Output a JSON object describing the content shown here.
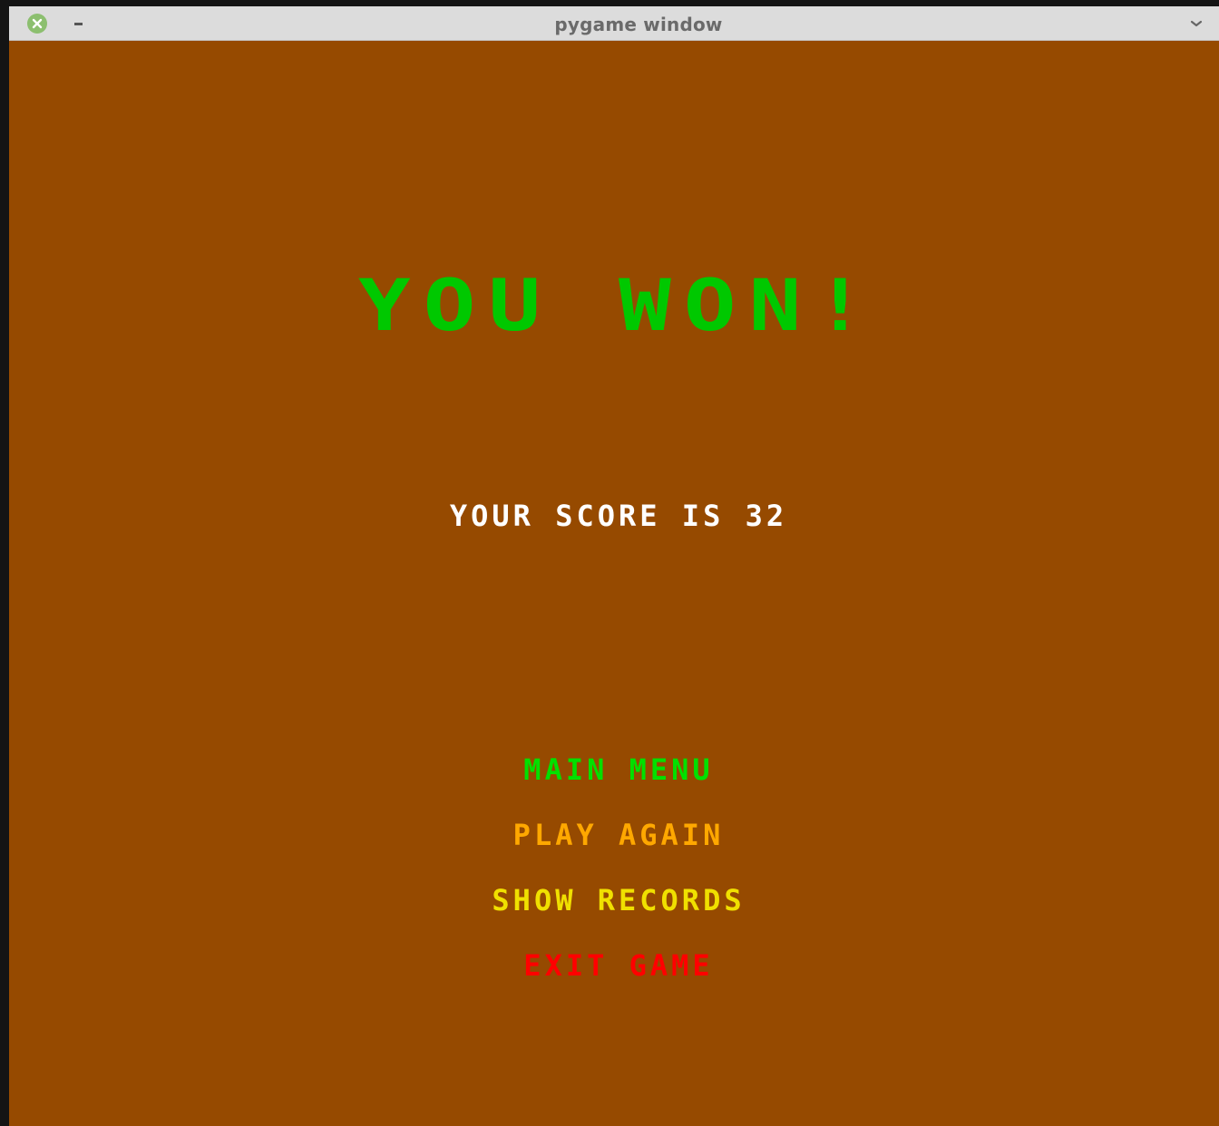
{
  "window": {
    "title": "pygame window"
  },
  "colors": {
    "background": "#964a00",
    "headline": "#00c800",
    "score": "#ffffff",
    "titlebar": "#dcdcdc"
  },
  "screen": {
    "headline": "YOU WON!",
    "score_text": "YOUR SCORE IS 32"
  },
  "menu": {
    "items": [
      {
        "label": "MAIN MENU",
        "color": "#00e000"
      },
      {
        "label": "PLAY AGAIN",
        "color": "#ffa800"
      },
      {
        "label": "SHOW RECORDS",
        "color": "#f0e000"
      },
      {
        "label": "EXIT GAME",
        "color": "#ff0000"
      }
    ]
  },
  "icons": {
    "close": "close-icon",
    "minimize": "minimize-icon",
    "menu": "chevron-down-icon"
  }
}
